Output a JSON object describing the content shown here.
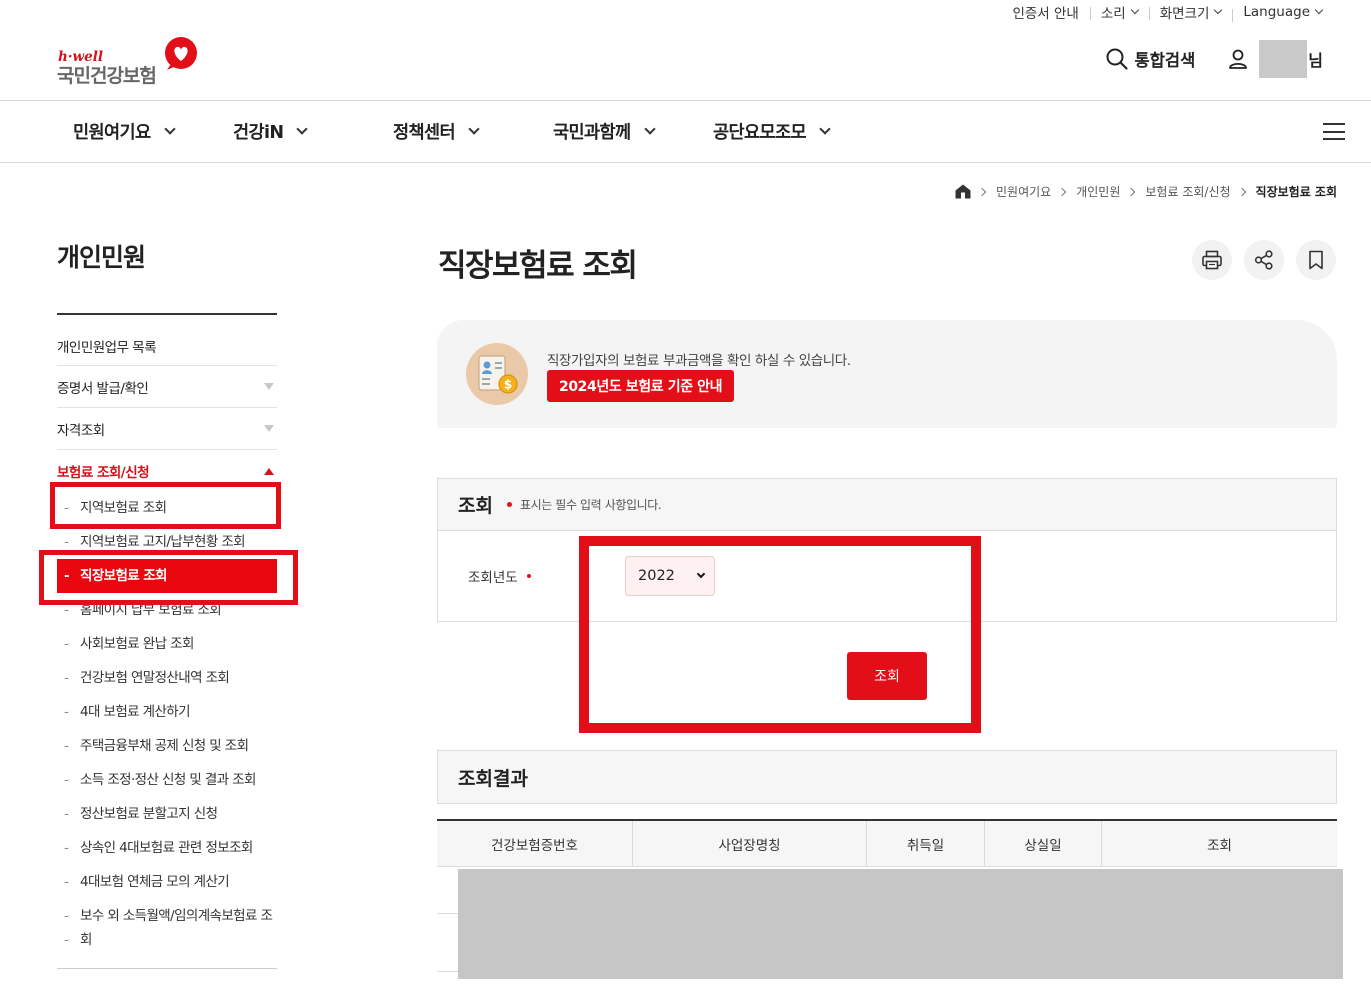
{
  "utility": {
    "items": [
      "인증서 안내",
      "소리",
      "화면크기",
      "Language"
    ]
  },
  "logo": {
    "brand": "h·well",
    "name": "국민건강보험"
  },
  "header": {
    "search_label": "통합검색",
    "user_suffix": "님"
  },
  "gnb": {
    "items": [
      "민원여기요",
      "건강iN",
      "정책센터",
      "국민과함께",
      "공단요모조모"
    ]
  },
  "breadcrumb": [
    "민원여기요",
    "개인민원",
    "보험료 조회/신청",
    "직장보험료 조회"
  ],
  "lnb": {
    "title": "개인민원",
    "items": [
      "개인민원업무 목록",
      "증명서 발급/확인",
      "자격조회",
      "보험료 조회/신청"
    ],
    "sub_items": [
      "지역보험료 조회",
      "지역보험료 고지/납부현황 조회",
      "직장보험료 조회",
      "홈페이지 납부 보험료 조회",
      "사회보험료 완납 조회",
      "건강보험 연말정산내역 조회",
      "4대 보험료 계산하기",
      "주택금융부채 공제 신청 및 조회",
      "소득 조정·정산 신청 및 결과 조회",
      "정산보험료 분할고지 신청",
      "상속인 4대보험료 관련 정보조회",
      "4대보험 연체금 모의 계산기",
      "보수 외 소득월액/임의계속보험료 조",
      "회"
    ]
  },
  "page": {
    "title": "직장보험료 조회"
  },
  "info": {
    "description": "직장가입자의 보험료 부과금액을 확인 하실 수 있습니다.",
    "guide_button": "2024년도 보험료 기준 안내"
  },
  "form": {
    "heading": "조회",
    "required_note": "표시는 필수 입력 사항입니다.",
    "year_label": "조회년도",
    "year_value": "2022",
    "submit_label": "조회"
  },
  "result": {
    "heading": "조회결과",
    "columns": [
      "건강보험증번호",
      "사업장명칭",
      "취득일",
      "상실일",
      "조회"
    ]
  },
  "colors": {
    "accent": "#e20e18",
    "annotation": "#e20e18"
  }
}
